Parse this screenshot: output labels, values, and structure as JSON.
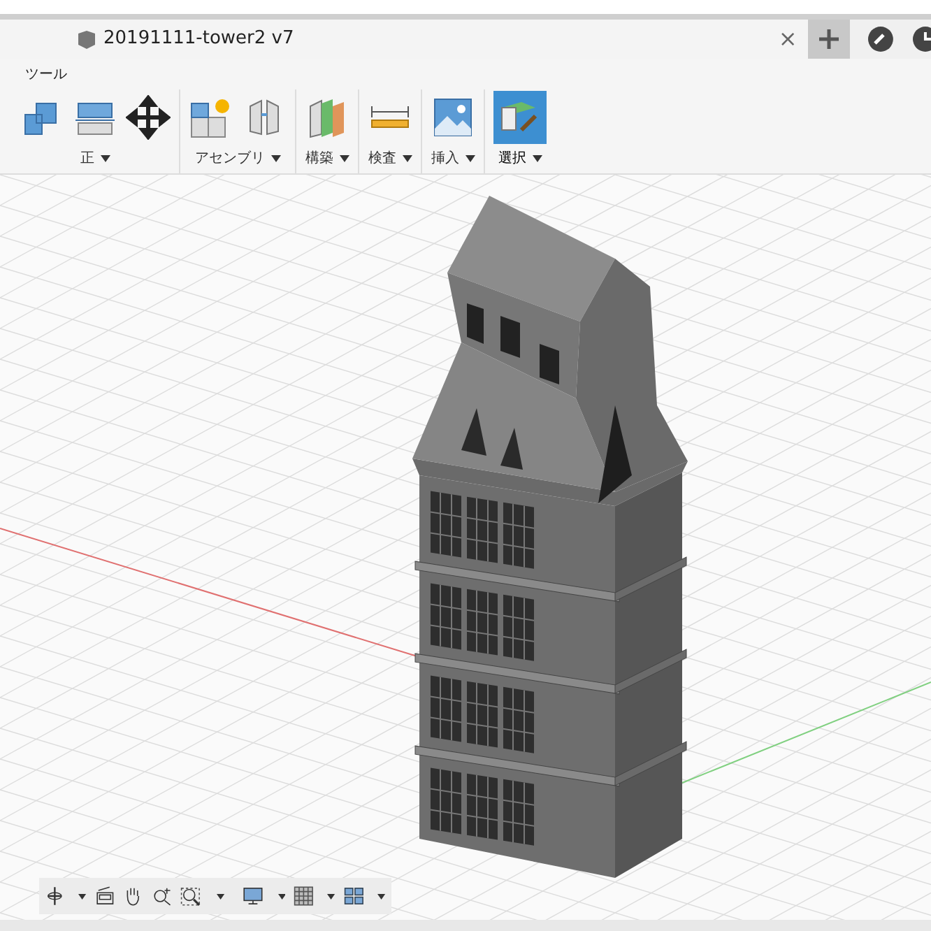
{
  "document_tab": {
    "title": "20191111-tower2 v7",
    "close": "×"
  },
  "toolbar_tab": {
    "label": "ツール"
  },
  "tool_groups": [
    {
      "kind": "modify",
      "label": "正",
      "selected": false
    },
    {
      "kind": "assemble",
      "label": "アセンブリ",
      "selected": false
    },
    {
      "kind": "construct",
      "label": "構築",
      "selected": false
    },
    {
      "kind": "inspect",
      "label": "検査",
      "selected": false
    },
    {
      "kind": "insert",
      "label": "挿入",
      "selected": false
    },
    {
      "kind": "select",
      "label": "選択",
      "selected": true
    }
  ]
}
